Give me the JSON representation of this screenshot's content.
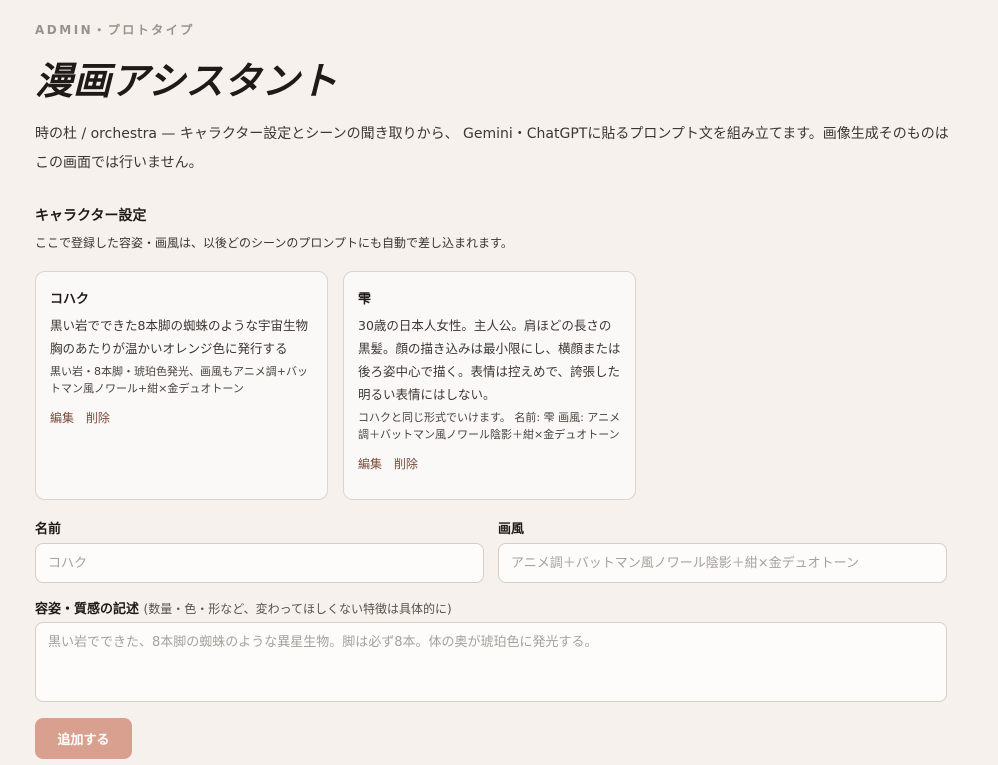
{
  "header": {
    "eyebrow": "ADMIN・プロトタイプ",
    "title": "漫画アシスタント",
    "description": "時の杜 / orchestra — キャラクター設定とシーンの聞き取りから、 Gemini・ChatGPTに貼るプロンプト文を組み立てます。画像生成そのものはこの画面では行いません。"
  },
  "characters_section": {
    "title": "キャラクター設定",
    "subtitle": "ここで登録した容姿・画風は、以後どのシーンのプロンプトにも自動で差し込まれます。",
    "cards": [
      {
        "name": "コハク",
        "looks": "黒い岩でできた8本脚の蜘蛛のような宇宙生物\n胸のあたりが温かいオレンジ色に発行する",
        "style": "黒い岩・8本脚・琥珀色発光、画風もアニメ調+バットマン風ノワール+紺×金デュオトーン",
        "edit_label": "編集",
        "delete_label": "削除"
      },
      {
        "name": "雫",
        "looks": "30歳の日本人女性。主人公。肩ほどの長さの黒髪。顔の描き込みは最小限にし、横顔または後ろ姿中心で描く。表情は控えめで、誇張した明るい表情にはしない。",
        "style": "コハクと同じ形式でいけます。 名前: 雫 画風: アニメ調＋バットマン風ノワール陰影＋紺×金デュオトーン",
        "edit_label": "編集",
        "delete_label": "削除"
      }
    ]
  },
  "form": {
    "name_label": "名前",
    "name_placeholder": "コハク",
    "style_label": "画風",
    "style_placeholder": "アニメ調＋バットマン風ノワール陰影＋紺×金デュオトーン",
    "looks_label": "容姿・質感の記述",
    "looks_hint": "(数量・色・形など、変わってほしくない特徴は具体的に)",
    "looks_placeholder": "黒い岩でできた、8本脚の蜘蛛のような異星生物。脚は必ず8本。体の奥が琥珀色に発光する。",
    "add_label": "追加する"
  }
}
